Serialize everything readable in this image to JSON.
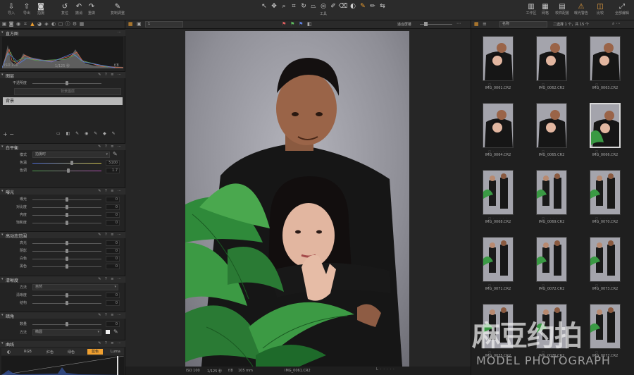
{
  "toolbar": {
    "left_buttons": [
      {
        "icon": "import-icon",
        "label": "导入"
      },
      {
        "icon": "export-icon",
        "label": "导出"
      },
      {
        "icon": "camera-icon",
        "label": "拍摄"
      },
      {
        "icon": "reset-icon",
        "label": "复位"
      },
      {
        "icon": "undo-icon",
        "label": "撤消"
      },
      {
        "icon": "redo-icon",
        "label": "重做"
      },
      {
        "icon": "copy-adjust-icon",
        "label": "复制调整"
      }
    ],
    "tools_label": "工具",
    "right_buttons": [
      {
        "icon": "workspace-icon",
        "label": "工作区"
      },
      {
        "icon": "grid-icon",
        "label": "网格"
      },
      {
        "icon": "proof-icon",
        "label": "校样配置"
      },
      {
        "icon": "exposure-warning-icon",
        "label": "曝光警告"
      },
      {
        "icon": "compare-icon",
        "label": "比较"
      },
      {
        "icon": "edit-all-icon",
        "label": "全部编辑"
      }
    ]
  },
  "left_panel": {
    "histogram_title": "直方图",
    "histogram_info": {
      "iso": "ISO 100",
      "shutter": "1/125 秒",
      "aperture": "f/8"
    },
    "layers_title": "图层",
    "layers_opacity_label": "不透明度",
    "layers_fill_button": "背景图层",
    "layer_selected": "背景",
    "white_balance": {
      "title": "白平衡",
      "mode_label": "模式",
      "mode_value": "拍摄时",
      "kelvin_label": "色温",
      "kelvin_value": "5100",
      "tint_label": "色调",
      "tint_value": "1.7"
    },
    "exposure": {
      "title": "曝光",
      "rows": [
        {
          "label": "曝光",
          "value": "0"
        },
        {
          "label": "对比度",
          "value": "0"
        },
        {
          "label": "亮度",
          "value": "0"
        },
        {
          "label": "饱和度",
          "value": "0"
        }
      ]
    },
    "hdr": {
      "title": "高动态范围",
      "rows": [
        {
          "label": "高光",
          "value": "0"
        },
        {
          "label": "阴影",
          "value": "0"
        },
        {
          "label": "白色",
          "value": "0"
        },
        {
          "label": "黑色",
          "value": "0"
        }
      ]
    },
    "clarity": {
      "title": "清晰度",
      "method_label": "方法",
      "method_value": "自然",
      "rows": [
        {
          "label": "清晰度",
          "value": "0"
        },
        {
          "label": "结构",
          "value": "0"
        }
      ]
    },
    "vignette": {
      "title": "暗角",
      "amount_label": "数量",
      "amount_value": "0",
      "method_label": "方法",
      "method_value": "椭圆"
    },
    "curve": {
      "title": "曲线",
      "tabs": [
        "RGB",
        "红色",
        "绿色",
        "蓝色"
      ]
    }
  },
  "viewer": {
    "bar_select": "1",
    "zoom_label": "适合屏幕",
    "status": {
      "iso": "ISO 100",
      "shutter": "1/125 秒",
      "aperture": "f/8",
      "focal": "105 mm",
      "filename": "IMG_0061.CR2"
    }
  },
  "browser": {
    "sort_label": "名称",
    "count_label": "二选择 1 个，共 15 个",
    "thumbnails": [
      "IMG_0061.CR2",
      "IMG_0062.CR2",
      "IMG_0063.CR2",
      "IMG_0064.CR2",
      "IMG_0065.CR2",
      "IMG_0066.CR2",
      "IMG_0068.CR2",
      "IMG_0069.CR2",
      "IMG_0070.CR2",
      "IMG_0071.CR2",
      "IMG_0072.CR2",
      "IMG_0073.CR2",
      "IMG_0075.CR2",
      "IMG_0076.CR2",
      "IMG_0077.CR2"
    ],
    "selected_thumbnail": "IMG_0066.CR2"
  },
  "watermark": {
    "main": "麻豆约拍",
    "sub": "MODEL PHOTOGRAPH"
  },
  "colors": {
    "accent": "#f0a030",
    "panel": "#232323",
    "backdrop": "#8e8e96"
  }
}
